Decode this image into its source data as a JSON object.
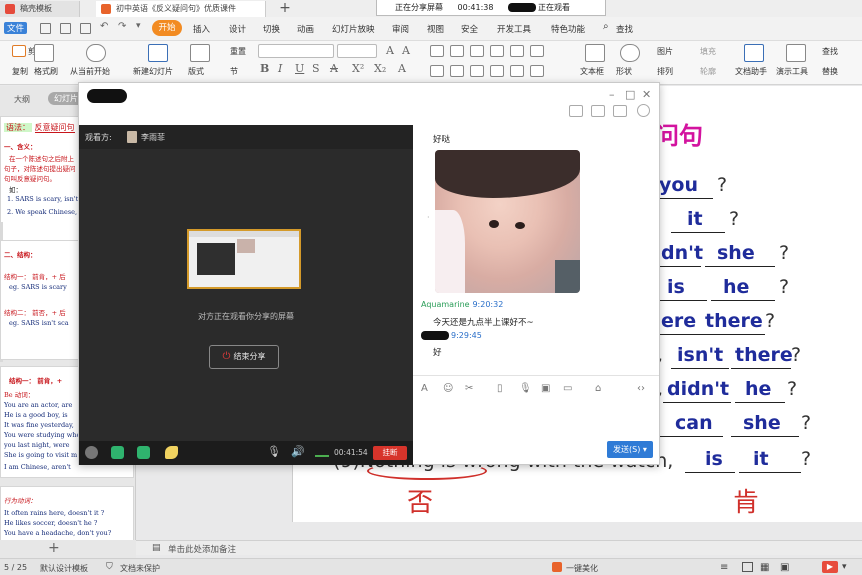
{
  "titlebar": {
    "tab1_label": "稿壳模板",
    "tab2_label": "初中英语《反义疑问句》优质课件",
    "add_tab": "+",
    "share_status": "正在分享屏幕",
    "share_time": "00:41:38",
    "watching_label": "正在观看"
  },
  "menu": {
    "file_label": "文件",
    "start": "开始",
    "items": [
      "插入",
      "设计",
      "切换",
      "动画",
      "幻灯片放映",
      "审阅",
      "视图",
      "安全",
      "开发工具",
      "特色功能"
    ],
    "search": "查找"
  },
  "ribbon": {
    "cut": "剪切",
    "copy": "复制",
    "format_painter": "格式刷",
    "play_from_current": "从当前开始",
    "new_slide": "新建幻灯片",
    "layout": "版式",
    "reset": "重置",
    "section": "节",
    "textbox": "文本框",
    "shape": "形状",
    "arrange": "排列",
    "picture": "图片",
    "fill": "填充",
    "outline": "轮廓",
    "doc_helper": "文档助手",
    "present_tools": "演示工具",
    "find": "查找",
    "replace": "替换"
  },
  "outline": {
    "tabs": [
      "大纲",
      "幻灯片"
    ],
    "thumb1": {
      "num": "1",
      "title_label": "语法：",
      "title_topic": "反意疑问句",
      "def_head": "一、含义：",
      "def1": "在一个陈述句之后附上",
      "def2": "句子，对陈述句提出疑问",
      "def3": "句叫反意疑问句。",
      "ex_head": "如：",
      "ex1": "1. SARS is scary, isn't",
      "ex2": "2. We speak Chinese,"
    },
    "thumb2": {
      "head": "二、结构：",
      "s1": "结构一： 前肯，+ 后",
      "s1e": "eg. SARS is scary",
      "s2": "结构二： 前否，+ 后",
      "s2e": "eg. SARS isn't sca"
    },
    "thumb3": {
      "head": "结构一： 前肯，+",
      "sub": "Be 动词：",
      "l1": "You are an actor, are",
      "l2": "He is a good boy, is",
      "l3": "It was fine yesterday,",
      "l4": "You were studying when",
      "l5": "you last night, were",
      "l6": "She is going to visit m",
      "l7": "I am Chinese, aren't"
    },
    "thumb4": {
      "head": "行为动词：",
      "l1": "It often rains here, doesn't it ?",
      "l2": "He likes soccer, doesn't he ?",
      "l3": "You have a headache, don't you?"
    }
  },
  "slide": {
    "title_fragment": "问句",
    "rows": [
      {
        "ans1": "you",
        "end": "?"
      },
      {
        "ans1": "it",
        "end": "?"
      },
      {
        "ans1": "dn't",
        "ans2": "she",
        "end": "?"
      },
      {
        "ans1": "is",
        "ans2": "he",
        "end": "?"
      },
      {
        "ans1": "ere",
        "ans2": "there",
        "end": "?"
      },
      {
        "ans1": "isn't",
        "ans2": "there",
        "end": "?"
      },
      {
        "ans1": "didn't",
        "ans2": "he",
        "end": "?"
      },
      {
        "ans1": "can",
        "ans2": "she",
        "end": "?"
      },
      {
        "ans1": "is",
        "ans2": "it",
        "end": "?"
      }
    ],
    "last_sentence": "(9)Nothing is wrong with the watch,",
    "handwriting_left": "否",
    "handwriting_right": "肯"
  },
  "chat": {
    "viewer_label": "观看方:",
    "viewer_name": "李雨菲",
    "share_message": "对方正在观看你分享的屏幕",
    "stop_share": "结束分享",
    "call_time": "00:41:54",
    "hangup": "挂断",
    "messages": [
      {
        "text": "好哒"
      },
      {
        "name": "Aquamarine",
        "time": "9:20:32",
        "text": "今天还是九点半上课好不~"
      },
      {
        "time": "9:29:45",
        "text": "好"
      }
    ],
    "send_label": "发送(S)"
  },
  "notes": {
    "placeholder": "单击此处添加备注"
  },
  "status": {
    "page": "5 / 25",
    "template": "默认设计模板",
    "protect": "文档未保护",
    "beautify": "一键美化"
  },
  "colors": {
    "accent": "#f28b22",
    "answer_blue": "#1f2c9b",
    "title_magenta": "#d3139f",
    "hangup_red": "#d7342b",
    "send_blue": "#2f7bd6",
    "chat_green": "#2a9d58"
  }
}
